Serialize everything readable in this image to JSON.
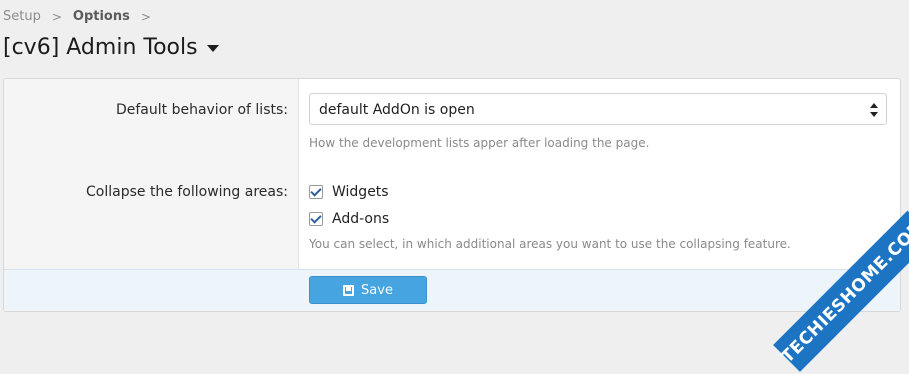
{
  "breadcrumb": {
    "items": [
      "Setup",
      "Options"
    ]
  },
  "page": {
    "title": "[cv6] Admin Tools"
  },
  "form": {
    "default_behavior": {
      "label": "Default behavior of lists:",
      "selected": "default AddOn is open",
      "hint": "How the development lists apper after loading the page."
    },
    "collapse": {
      "label": "Collapse the following areas:",
      "options": [
        {
          "label": "Widgets",
          "checked": true
        },
        {
          "label": "Add-ons",
          "checked": true
        }
      ],
      "hint": "You can select, in which additional areas you want to use the collapsing feature."
    }
  },
  "footer": {
    "save_label": "Save"
  },
  "watermark": {
    "text": "TECHIESHOME.COM"
  },
  "colors": {
    "save_button": "#46a4e0",
    "footer_bg": "#edf4fa",
    "watermark_bg": "#1d74c2"
  }
}
